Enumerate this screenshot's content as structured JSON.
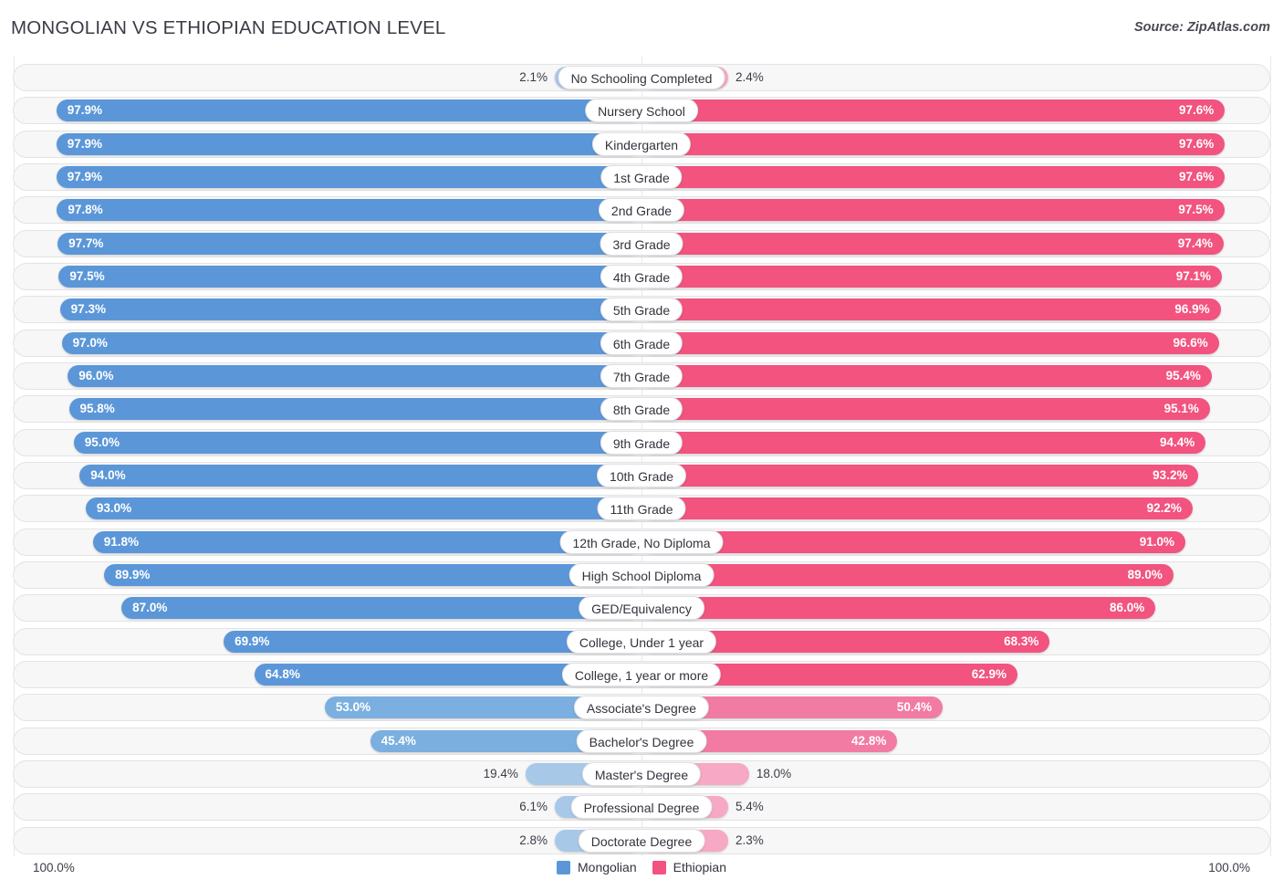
{
  "header": {
    "title": "MONGOLIAN VS ETHIOPIAN EDUCATION LEVEL",
    "source": "Source: ZipAtlas.com"
  },
  "footer": {
    "axis_left": "100.0%",
    "axis_right": "100.0%",
    "legend": [
      {
        "label": "Mongolian",
        "color": "#5b97d8"
      },
      {
        "label": "Ethiopian",
        "color": "#f2537f"
      }
    ]
  },
  "colors": {
    "blue_strong": "#5b97d8",
    "blue_mid": "#7aafe0",
    "blue_light": "#a8c8e8",
    "pink_strong": "#f2537f",
    "pink_mid": "#f27ba4",
    "pink_light": "#f7a8c4",
    "track_bg": "#f7f7f8",
    "track_border": "#e3e3e6"
  },
  "chart_data": {
    "type": "bar",
    "title": "MONGOLIAN VS ETHIOPIAN EDUCATION LEVEL",
    "subtitle": "",
    "orientation": "horizontal-diverging",
    "xlabel": "",
    "ylabel": "",
    "xlim": [
      0,
      100
    ],
    "grid": false,
    "legend_position": "bottom-center",
    "categories": [
      "No Schooling Completed",
      "Nursery School",
      "Kindergarten",
      "1st Grade",
      "2nd Grade",
      "3rd Grade",
      "4th Grade",
      "5th Grade",
      "6th Grade",
      "7th Grade",
      "8th Grade",
      "9th Grade",
      "10th Grade",
      "11th Grade",
      "12th Grade, No Diploma",
      "High School Diploma",
      "GED/Equivalency",
      "College, Under 1 year",
      "College, 1 year or more",
      "Associate's Degree",
      "Bachelor's Degree",
      "Master's Degree",
      "Professional Degree",
      "Doctorate Degree"
    ],
    "series": [
      {
        "name": "Mongolian",
        "color": "#5b97d8",
        "side": "left",
        "values": [
          2.1,
          97.9,
          97.9,
          97.9,
          97.8,
          97.7,
          97.5,
          97.3,
          97.0,
          96.0,
          95.8,
          95.0,
          94.0,
          93.0,
          91.8,
          89.9,
          87.0,
          69.9,
          64.8,
          53.0,
          45.4,
          19.4,
          6.1,
          2.8
        ],
        "labels": [
          "2.1%",
          "97.9%",
          "97.9%",
          "97.9%",
          "97.8%",
          "97.7%",
          "97.5%",
          "97.3%",
          "97.0%",
          "96.0%",
          "95.8%",
          "95.0%",
          "94.0%",
          "93.0%",
          "91.8%",
          "89.9%",
          "87.0%",
          "69.9%",
          "64.8%",
          "53.0%",
          "45.4%",
          "19.4%",
          "6.1%",
          "2.8%"
        ]
      },
      {
        "name": "Ethiopian",
        "color": "#f2537f",
        "side": "right",
        "values": [
          2.4,
          97.6,
          97.6,
          97.6,
          97.5,
          97.4,
          97.1,
          96.9,
          96.6,
          95.4,
          95.1,
          94.4,
          93.2,
          92.2,
          91.0,
          89.0,
          86.0,
          68.3,
          62.9,
          50.4,
          42.8,
          18.0,
          5.4,
          2.3
        ],
        "labels": [
          "2.4%",
          "97.6%",
          "97.6%",
          "97.6%",
          "97.5%",
          "97.4%",
          "97.1%",
          "96.9%",
          "96.6%",
          "95.4%",
          "95.1%",
          "94.4%",
          "93.2%",
          "92.2%",
          "91.0%",
          "89.0%",
          "86.0%",
          "68.3%",
          "62.9%",
          "50.4%",
          "42.8%",
          "18.0%",
          "5.4%",
          "2.3%"
        ]
      }
    ]
  }
}
